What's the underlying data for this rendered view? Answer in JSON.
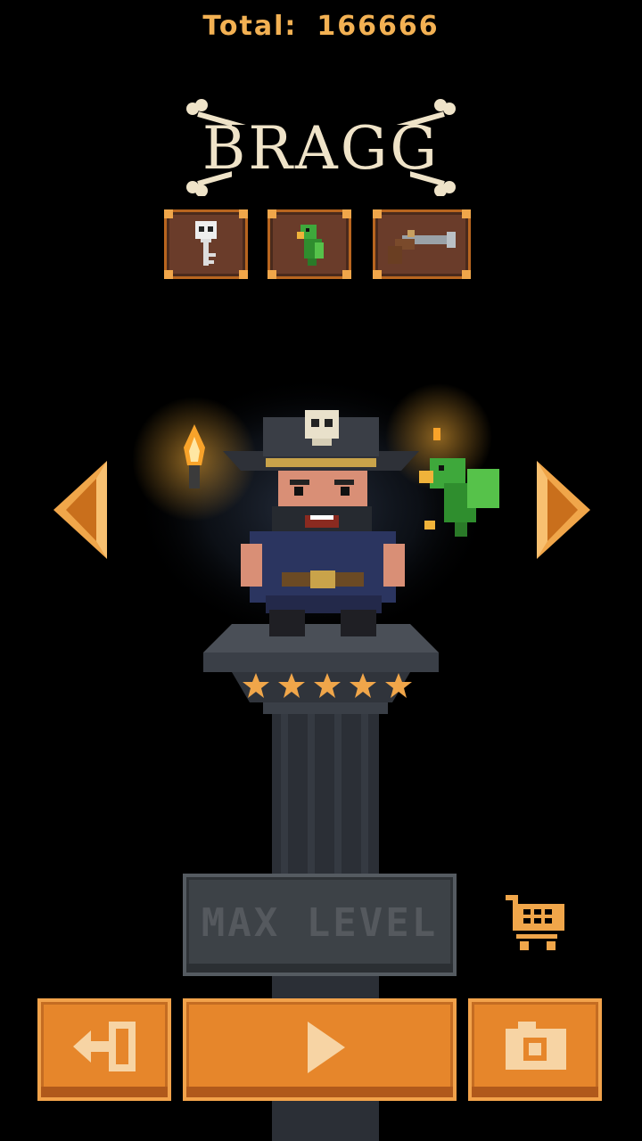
{
  "header": {
    "total_label": "Total:",
    "total_value": "166666"
  },
  "character": {
    "name": "BRAGG",
    "stars": 5
  },
  "items": [
    {
      "icon": "skull-key-icon"
    },
    {
      "icon": "parrot-icon"
    },
    {
      "icon": "flintlock-pistol-icon"
    }
  ],
  "actions": {
    "max_level_label": "MAX LEVEL"
  },
  "colors": {
    "accent": "#e6862b",
    "gold_text": "#f3b153",
    "title_bone": "#efe3c8",
    "disabled_button": "#3d4247"
  }
}
